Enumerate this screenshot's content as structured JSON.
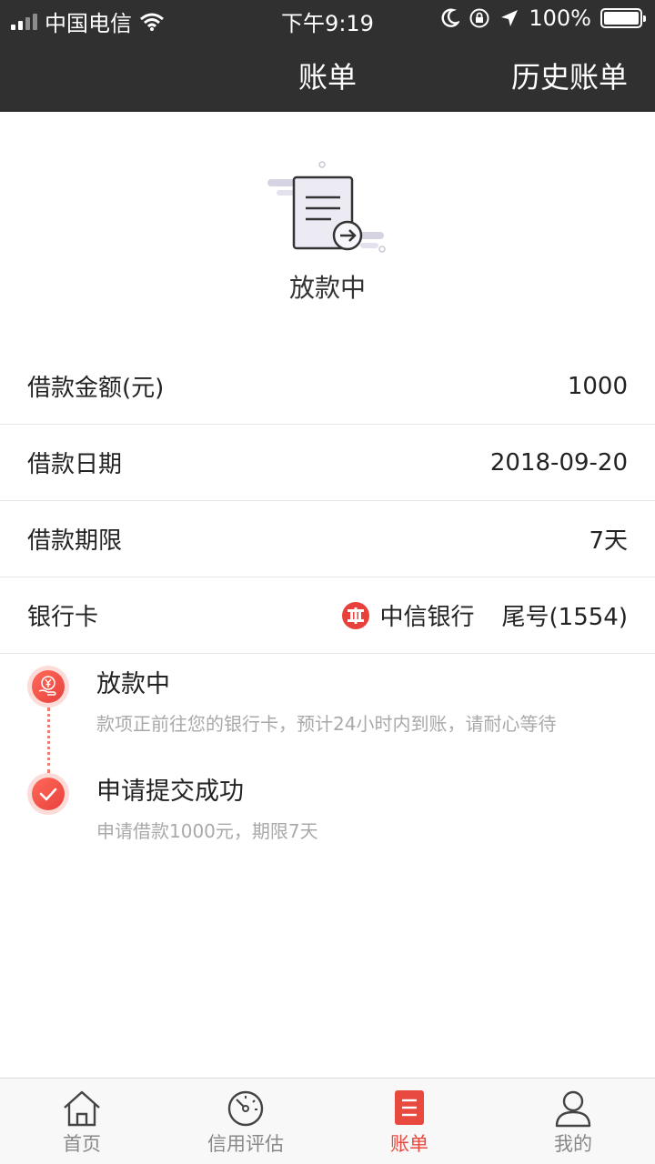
{
  "status_bar": {
    "carrier": "中国电信",
    "time": "下午9:19",
    "battery": "100%"
  },
  "nav": {
    "title": "账单",
    "right_action": "历史账单"
  },
  "hero": {
    "status": "放款中"
  },
  "info": {
    "amount_label": "借款金额(元)",
    "amount_value": "1000",
    "date_label": "借款日期",
    "date_value": "2018-09-20",
    "term_label": "借款期限",
    "term_value": "7天",
    "card_label": "银行卡",
    "bank_name": "中信银行",
    "card_tail": "尾号(1554)"
  },
  "timeline": [
    {
      "title": "放款中",
      "desc": "款项正前往您的银行卡，预计24小时内到账，请耐心等待"
    },
    {
      "title": "申请提交成功",
      "desc": "申请借款1000元，期限7天"
    }
  ],
  "tabs": [
    {
      "label": "首页",
      "icon": "home-icon"
    },
    {
      "label": "信用评估",
      "icon": "gauge-icon"
    },
    {
      "label": "账单",
      "icon": "bill-icon"
    },
    {
      "label": "我的",
      "icon": "user-icon"
    }
  ],
  "colors": {
    "header_bg": "#303030",
    "accent": "#e84a3f",
    "muted_text": "#a9a9a9"
  }
}
